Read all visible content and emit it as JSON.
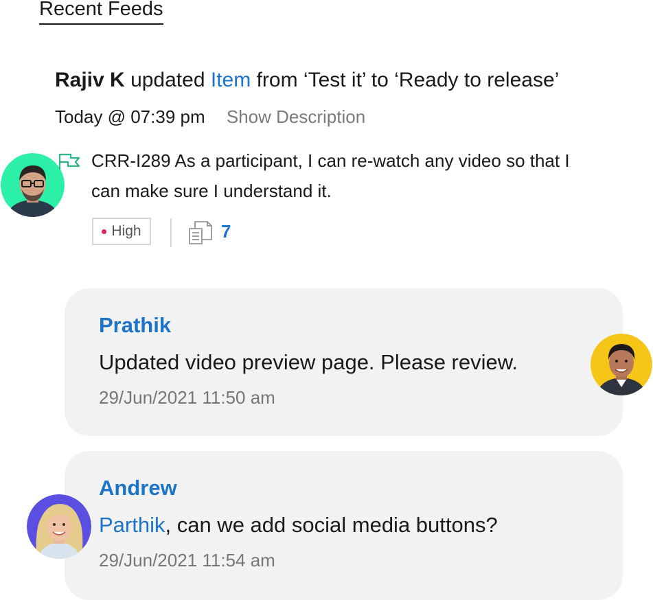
{
  "section": {
    "title": "Recent Feeds"
  },
  "activity": {
    "actor": "Rajiv K",
    "verb": "updated",
    "link_text": "Item",
    "change_text": "from ‘Test it’ to ‘Ready to release’",
    "time": "Today @ 07:39 pm",
    "show_description": "Show Description"
  },
  "item": {
    "icon": "flag-icon",
    "text": "CRR-I289 As a participant, I can re-watch any video so that I can make sure I understand it.",
    "priority": "High",
    "doc_count": "7",
    "colors": {
      "priority_dot": "#e0245e",
      "accent": "#1b74c7",
      "flag": "#2bb38a"
    }
  },
  "comments": [
    {
      "author": "Prathik",
      "message": "Updated video preview page. Please review.",
      "timestamp": "29/Jun/2021 11:50 am"
    },
    {
      "author": "Andrew",
      "mention": "Parthik",
      "message": ", can we add social media buttons?",
      "timestamp": "29/Jun/2021 11:54 am"
    }
  ],
  "avatars": {
    "rajiv_bg": "#2df0a8",
    "prathik_bg": "#f5c518",
    "andrew_bg": "#5a4fe0"
  }
}
